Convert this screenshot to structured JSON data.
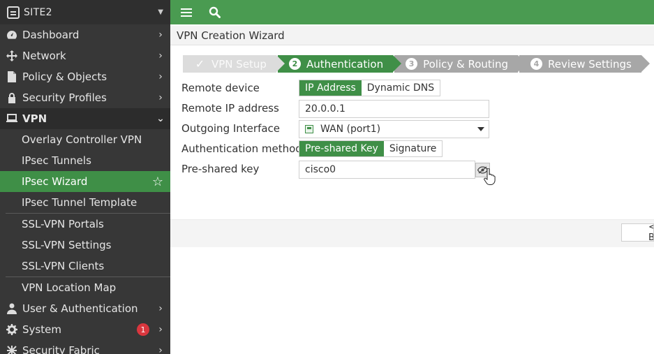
{
  "sidebar": {
    "device_name": "SITE2",
    "items": [
      {
        "label": "Dashboard"
      },
      {
        "label": "Network"
      },
      {
        "label": "Policy & Objects"
      },
      {
        "label": "Security Profiles"
      },
      {
        "label": "VPN"
      },
      {
        "label": "User & Authentication"
      },
      {
        "label": "System",
        "badge": "1"
      },
      {
        "label": "Security Fabric"
      }
    ],
    "vpn_sub": [
      "Overlay Controller VPN",
      "IPsec Tunnels",
      "IPsec Wizard",
      "IPsec Tunnel Template",
      "SSL-VPN Portals",
      "SSL-VPN Settings",
      "SSL-VPN Clients",
      "VPN Location Map"
    ]
  },
  "page_title": "VPN Creation Wizard",
  "steps": [
    {
      "label": "VPN Setup",
      "state": "done"
    },
    {
      "number": "2",
      "label": "Authentication",
      "state": "current"
    },
    {
      "number": "3",
      "label": "Policy & Routing",
      "state": "todo"
    },
    {
      "number": "4",
      "label": "Review Settings",
      "state": "todo"
    }
  ],
  "form": {
    "remote_device": {
      "label": "Remote device",
      "options": [
        "IP Address",
        "Dynamic DNS"
      ],
      "selected": "IP Address"
    },
    "remote_ip": {
      "label": "Remote IP address",
      "value": "20.0.0.1"
    },
    "outgoing_interface": {
      "label": "Outgoing Interface",
      "value": "WAN (port1)"
    },
    "auth_method": {
      "label": "Authentication method",
      "options": [
        "Pre-shared Key",
        "Signature"
      ],
      "selected": "Pre-shared Key"
    },
    "psk": {
      "label": "Pre-shared key",
      "value": "cisco0"
    }
  },
  "footer": {
    "prev_label": "< Back"
  },
  "colors": {
    "accent": "#3f8f47",
    "topbar": "#4a9b51",
    "sidebar": "#373737",
    "badge": "#d9363e"
  }
}
